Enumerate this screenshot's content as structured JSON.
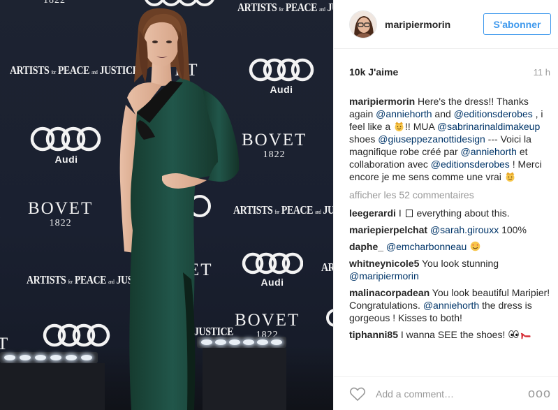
{
  "photo": {
    "backdrop": {
      "apj_main": "ARTISTS",
      "apj_for": "for",
      "apj_peace": "PEACE",
      "apj_and": "and",
      "apj_justice": "JUSTICE",
      "bovet": "BOVET",
      "bovet_year": "1822",
      "audi": "Audi",
      "partial_1822": "1822",
      "partial_et": "ET",
      "partial_justice": "JUSTICE",
      "partial_e": "E",
      "partial_t": "T",
      "partial_art": "ART",
      "partial_a": "A"
    }
  },
  "header": {
    "username": "maripiermorin",
    "follow_label": "S'abonner"
  },
  "stats": {
    "likes": "10k J'aime",
    "time": "11 h"
  },
  "caption": {
    "user": "maripiermorin",
    "t1": " Here's the dress!! Thanks again ",
    "m1": "@anniehorth",
    "t2": " and ",
    "m2": "@editionsderobes",
    "t3": " , i feel like a ",
    "t4": "!! MUA ",
    "m3": "@sabrinarinaldimakeup",
    "t5": " shoes ",
    "m4": "@giuseppezanottidesign",
    "t6": " --- Voici la magnifique robe créé par ",
    "m5": "@anniehorth",
    "t7": " et collaboration avec ",
    "m6": "@editionsderobes",
    "t8": " ! Merci encore je me sens comme une vrai "
  },
  "more_comments": "afficher les 52 commentaires",
  "comments": [
    {
      "user": "leegerardi",
      "text_a": " I ",
      "text_b": " everything about this."
    },
    {
      "user": "mariepierpelchat",
      "mention": "@sarah.girouxx",
      "text": " 100%"
    },
    {
      "user": "daphe_",
      "mention": "@emcharbonneau"
    },
    {
      "user": "whitneynicole5",
      "text": " You look stunning ",
      "mention": "@maripiermorin"
    },
    {
      "user": "malinacorpadean",
      "text_a": " You look beautiful Maripier! Congratulations. ",
      "mention": "@anniehorth",
      "text_b": " the dress is gorgeous ! Kisses to both!"
    },
    {
      "user": "tiphanni85",
      "text": " I wanna SEE the shoes! "
    }
  ],
  "footer": {
    "placeholder": "Add a comment…",
    "more": "ooo"
  },
  "colors": {
    "accent": "#3f99ed",
    "mention": "#003569",
    "muted": "#999999",
    "backdrop": "#1c2230",
    "dress": "#1d4a3a"
  },
  "icons": [
    "heart-icon",
    "crown-emoji",
    "smiling-hearts-emoji",
    "eyes-emoji",
    "high-heel-emoji",
    "audi-rings-logo"
  ]
}
